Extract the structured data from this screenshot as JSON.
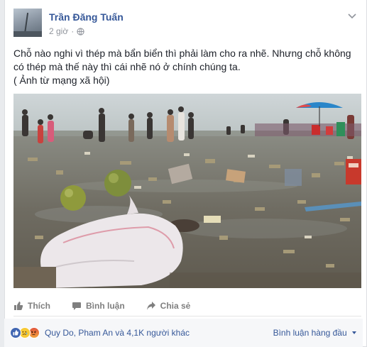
{
  "post": {
    "author": "Trần Đăng Tuấn",
    "time": "2 giờ",
    "text_lines": [
      "Chỗ nào nghi vì thép mà bẩn biển thì phải làm cho ra nhẽ. Nhưng chỗ không",
      "có thép mà thế này thì cái nhẽ nó ở chính chúng ta.",
      "( Ảnh từ mạng xã hội)"
    ]
  },
  "actions": {
    "like": "Thích",
    "comment": "Bình luận",
    "share": "Chia sẻ"
  },
  "reactions": {
    "summary": "Quy Do, Pham An và 4,1K người khác",
    "sort_label": "Bình luận hàng đầu"
  },
  "icons": [
    "globe-icon",
    "chevron-down-icon",
    "like-icon",
    "comment-icon",
    "share-icon",
    "like-reaction-icon",
    "sad-reaction-icon",
    "angry-reaction-icon",
    "sort-caret-icon"
  ],
  "colors": {
    "link": "#365899",
    "facebook_blue": "#4267b2"
  }
}
